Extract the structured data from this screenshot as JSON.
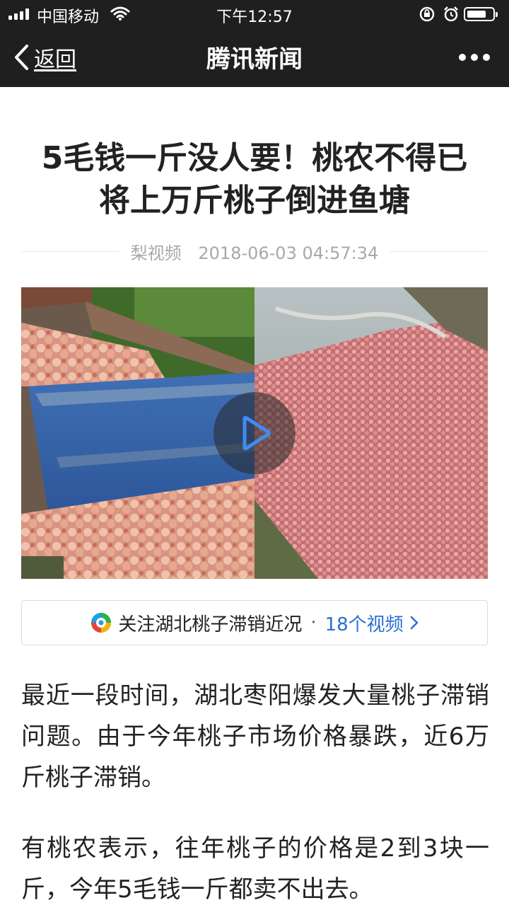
{
  "status_bar": {
    "carrier": "中国移动",
    "time": "下午12:57"
  },
  "nav": {
    "back_label": "返回",
    "title": "腾讯新闻"
  },
  "article": {
    "headline": "5毛钱一斤没人要！桃农不得已将上万斤桃子倒进鱼塘",
    "source": "梨视频",
    "datetime": "2018-06-03 04:57:34",
    "topic_text": "关注湖北桃子滞销近况",
    "topic_separator": "·",
    "topic_link": "18个视频",
    "paragraphs": [
      "最近一段时间，湖北枣阳爆发大量桃子滞销问题。由于今年桃子市场价格暴跌，近6万斤桃子滞销。",
      "有桃农表示，往年桃子的价格是2到3块一斤，今年5毛钱一斤都卖不出去。"
    ]
  },
  "colors": {
    "topbar": "#1f1f1f",
    "link": "#2c6fd1",
    "text": "#222222",
    "meta": "#a8a8a8"
  },
  "icons": [
    "signal-icon",
    "wifi-icon",
    "rotation-lock-icon",
    "alarm-icon",
    "battery-icon",
    "back-chevron-icon",
    "more-icon",
    "play-icon",
    "tencent-video-logo",
    "chevron-right-icon"
  ]
}
